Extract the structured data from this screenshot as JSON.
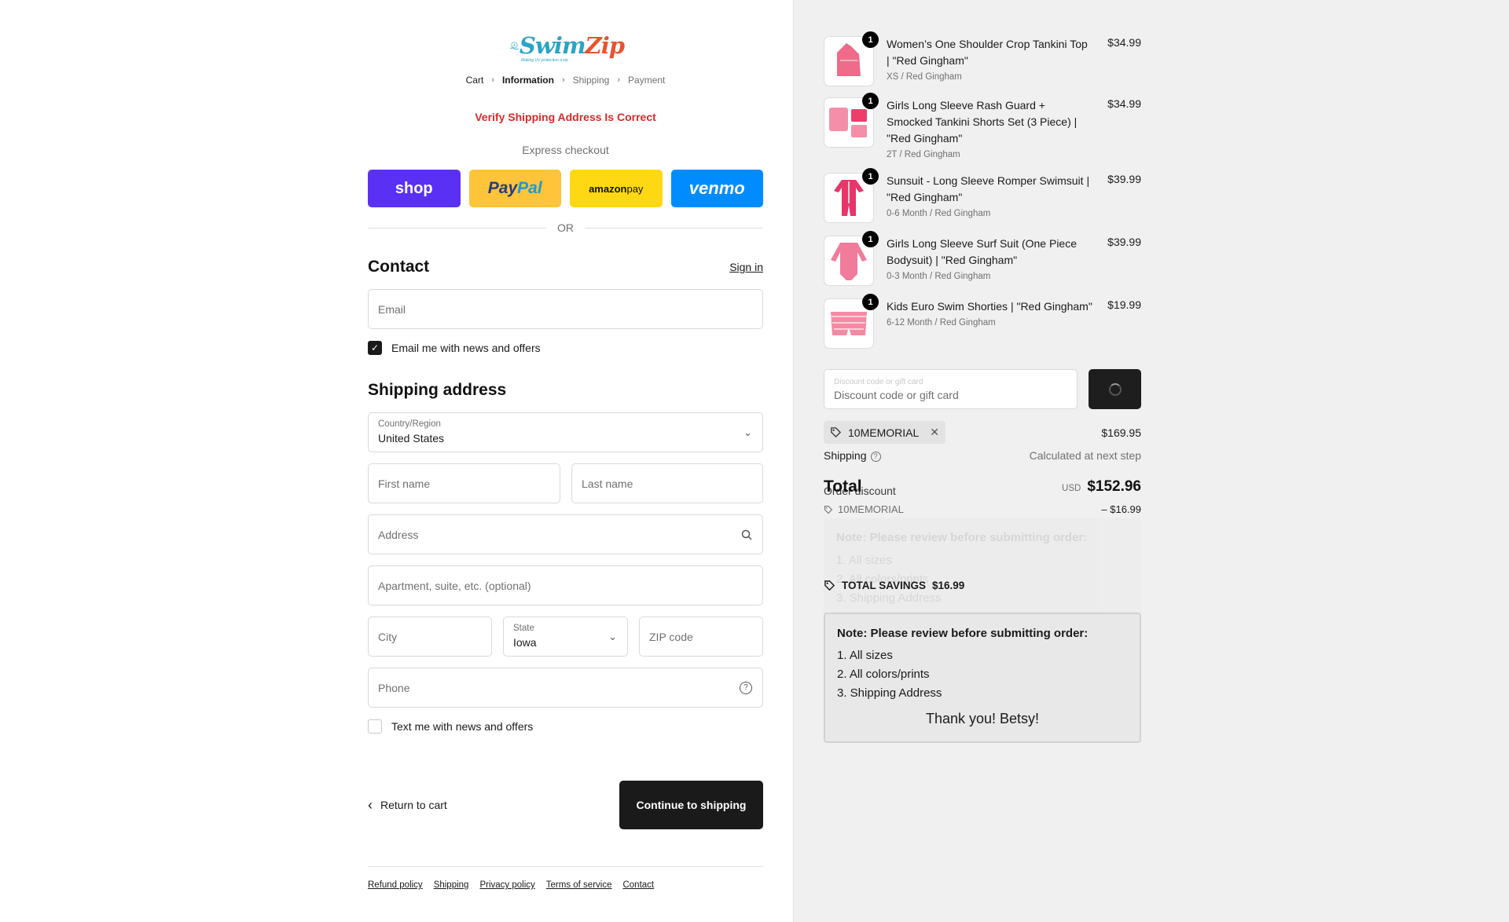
{
  "brand": {
    "name_part1": "Swim",
    "name_part2": "Zip",
    "tagline": "Making UV protection a zip"
  },
  "breadcrumb": [
    {
      "label": "Cart",
      "state": "link"
    },
    {
      "label": "Information",
      "state": "current"
    },
    {
      "label": "Shipping",
      "state": "inactive"
    },
    {
      "label": "Payment",
      "state": "inactive"
    }
  ],
  "alert": "Verify Shipping Address Is Correct",
  "express": {
    "label": "Express checkout",
    "buttons": {
      "shop": "shop",
      "paypal_a": "Pay",
      "paypal_b": "Pal",
      "amazon_a": "amazon",
      "amazon_b": " pay",
      "venmo": "venmo"
    },
    "divider": "OR"
  },
  "contact": {
    "title": "Contact",
    "signin": "Sign in",
    "email_placeholder": "Email",
    "news_checkbox": "Email me with news and offers",
    "news_checked": true
  },
  "shipping": {
    "title": "Shipping address",
    "country_label": "Country/Region",
    "country_value": "United States",
    "first_name_placeholder": "First name",
    "last_name_placeholder": "Last name",
    "address_placeholder": "Address",
    "apartment_placeholder": "Apartment, suite, etc. (optional)",
    "city_placeholder": "City",
    "state_label": "State",
    "state_value": "Iowa",
    "zip_placeholder": "ZIP code",
    "phone_placeholder": "Phone",
    "sms_checkbox": "Text me with news and offers",
    "sms_checked": false
  },
  "actions": {
    "return": "Return to cart",
    "continue": "Continue to shipping"
  },
  "footer": [
    "Refund policy",
    "Shipping",
    "Privacy policy",
    "Terms of service",
    "Contact"
  ],
  "cart": {
    "items": [
      {
        "name": "Women’s One Shoulder Crop Tankini Top | \"Red Gingham\"",
        "variant": "XS / Red Gingham",
        "price": "$34.99",
        "qty": "1"
      },
      {
        "name": "Girls Long Sleeve Rash Guard + Smocked Tankini Shorts Set (3 Piece) | \"Red Gingham\"",
        "variant": "2T / Red Gingham",
        "price": "$34.99",
        "qty": "1"
      },
      {
        "name": "Sunsuit - Long Sleeve Romper Swimsuit | \"Red Gingham\"",
        "variant": "0-6 Month / Red Gingham",
        "price": "$39.99",
        "qty": "1"
      },
      {
        "name": "Girls Long Sleeve Surf Suit (One Piece Bodysuit) | \"Red Gingham\"",
        "variant": "0-3 Month / Red Gingham",
        "price": "$39.99",
        "qty": "1"
      },
      {
        "name": "Kids Euro Swim Shorties | \"Red Gingham\"",
        "variant": "6-12 Month / Red Gingham",
        "price": "$19.99",
        "qty": "1"
      }
    ],
    "discount_ghost_placeholder": "Discount code or gift card",
    "discount_placeholder": "Discount code or gift card",
    "applied_code": "10MEMORIAL",
    "subtotal": "$169.95",
    "shipping_label": "Shipping",
    "shipping_value": "Calculated at next step",
    "total_label": "Total",
    "order_discount_label": "Order discount",
    "currency": "USD",
    "total_value": "$152.96",
    "discount_code": "10MEMORIAL",
    "discount_amount": "– $16.99",
    "savings_label": "TOTAL SAVINGS",
    "savings_value": "$16.99"
  },
  "note": {
    "title": "Note: Please review before submitting order:",
    "items": [
      "1. All sizes",
      "2. All colors/prints",
      "3. Shipping Address"
    ],
    "thanks": "Thank you! Betsy!"
  },
  "colors": {
    "alert": "#d62b2b",
    "shop": "#5a31f4",
    "paypal": "#ffc439",
    "amazon": "#ffd814",
    "venmo": "#008cff",
    "primary_button": "#1a1a1a",
    "product_pink": "#f06a8a"
  }
}
